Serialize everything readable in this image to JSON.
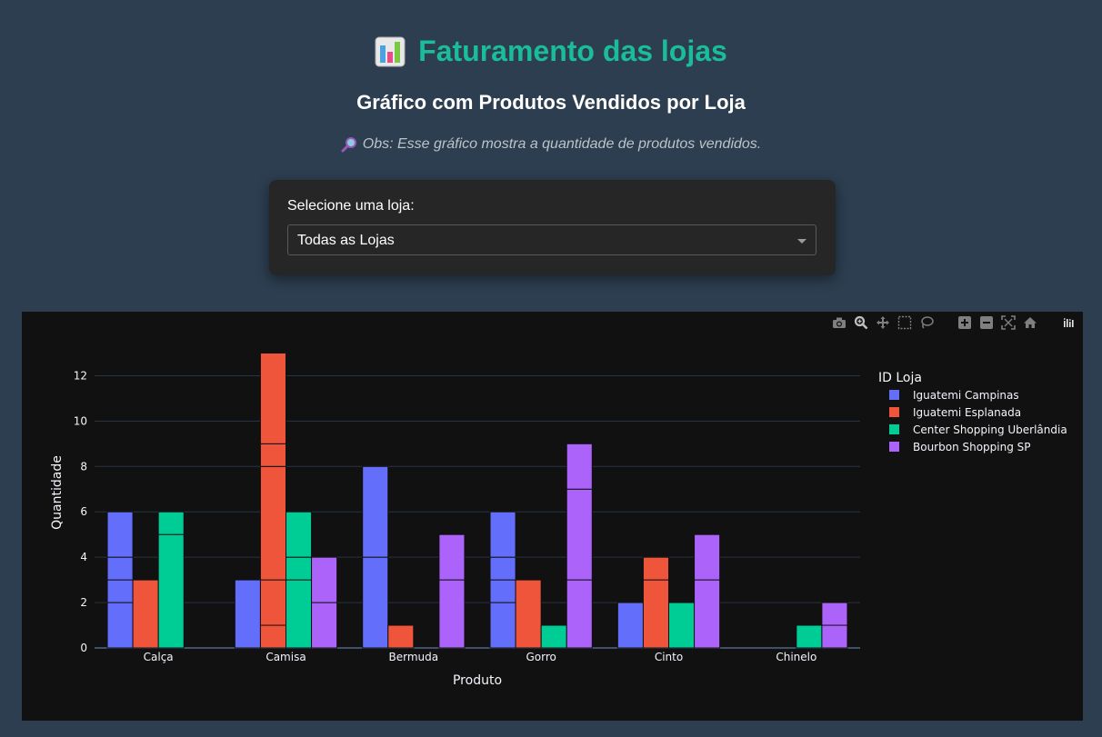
{
  "header": {
    "title": "Faturamento das lojas",
    "title_icon": "bar-chart-emoji-icon",
    "subtitle": "Gráfico com Produtos Vendidos por Loja",
    "note_icon": "magnifying-glass-icon",
    "note": "Obs: Esse gráfico mostra a quantidade de produtos vendidos."
  },
  "store_selector": {
    "label": "Selecione uma loja:",
    "selected": "Todas as Lojas"
  },
  "modebar": {
    "icons": [
      "camera-icon",
      "zoom-icon",
      "pan-icon",
      "box-select-icon",
      "lasso-select-icon",
      "zoom-in-icon",
      "zoom-out-icon",
      "autoscale-icon",
      "reset-axes-icon",
      "plotly-logo-icon"
    ]
  },
  "colors": {
    "page_bg": "#2c3e50",
    "title": "#1abc9c",
    "plot_bg": "#111111"
  },
  "chart_data": {
    "type": "bar",
    "barmode": "group",
    "categories": [
      "Calça",
      "Camisa",
      "Bermuda",
      "Gorro",
      "Cinto",
      "Chinelo"
    ],
    "xlabel": "Produto",
    "ylabel": "Quantidade",
    "ylim": [
      0,
      13.7
    ],
    "yticks": [
      0,
      2,
      4,
      6,
      8,
      10,
      12
    ],
    "grid": true,
    "legend": {
      "title": "ID Loja",
      "position": "right"
    },
    "series": [
      {
        "name": "Iguatemi Campinas",
        "color": "#636efa",
        "segments": [
          [
            2,
            1,
            1,
            2
          ],
          [
            3
          ],
          [
            4,
            4
          ],
          [
            2,
            1,
            1,
            2
          ],
          [
            2
          ],
          []
        ]
      },
      {
        "name": "Iguatemi Esplanada",
        "color": "#ef553b",
        "segments": [
          [
            3
          ],
          [
            1,
            2,
            5,
            1,
            4
          ],
          [
            1
          ],
          [
            3
          ],
          [
            3,
            1
          ],
          []
        ]
      },
      {
        "name": "Center Shopping Uberlândia",
        "color": "#00cc96",
        "segments": [
          [
            5,
            1
          ],
          [
            3,
            1,
            2
          ],
          [],
          [
            1
          ],
          [
            2
          ],
          [
            1
          ]
        ]
      },
      {
        "name": "Bourbon Shopping SP",
        "color": "#ab63fa",
        "segments": [
          [],
          [
            2,
            2
          ],
          [
            3,
            2
          ],
          [
            3,
            4,
            2
          ],
          [
            3,
            2
          ],
          [
            1,
            1
          ]
        ]
      }
    ]
  }
}
